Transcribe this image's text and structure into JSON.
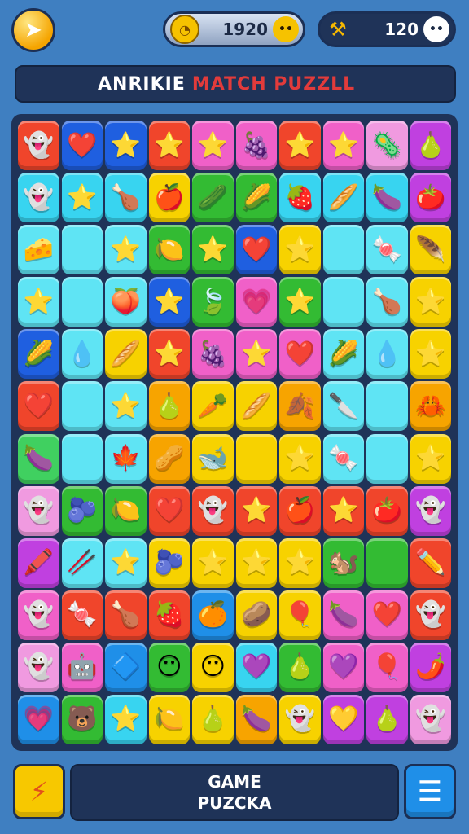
{
  "header": {
    "timer_value": "1920",
    "score_value": "120",
    "icons": {
      "back": "back-arrow-icon",
      "clock": "clock-icon",
      "tool": "hammer-icon",
      "options": "face-icon"
    }
  },
  "title": {
    "part1": "ANRIKIE",
    "part2": "MATCH  PUZZLL"
  },
  "board": {
    "tiles": [
      {
        "r": 0,
        "c": 0,
        "color": "#f0452b",
        "glyph": "👻"
      },
      {
        "r": 0,
        "c": 1,
        "color": "#1f5fe0",
        "glyph": "❤️"
      },
      {
        "r": 0,
        "c": 2,
        "color": "#1f5fe0",
        "glyph": "⭐"
      },
      {
        "r": 0,
        "c": 3,
        "color": "#f0452b",
        "glyph": "⭐"
      },
      {
        "r": 0,
        "c": 4,
        "color": "#f060c8",
        "glyph": "⭐"
      },
      {
        "r": 0,
        "c": 5,
        "color": "#f060c8",
        "glyph": "🍇"
      },
      {
        "r": 0,
        "c": 6,
        "color": "#f0452b",
        "glyph": "⭐"
      },
      {
        "r": 0,
        "c": 7,
        "color": "#f060c8",
        "glyph": "⭐"
      },
      {
        "r": 0,
        "c": 8,
        "color": "#f09ae0",
        "glyph": "🦠"
      },
      {
        "r": 0,
        "c": 9,
        "color": "#c040e0",
        "glyph": "🍐"
      },
      {
        "r": 1,
        "c": 0,
        "color": "#38d4f0",
        "glyph": "👻"
      },
      {
        "r": 1,
        "c": 1,
        "color": "#38d4f0",
        "glyph": "⭐"
      },
      {
        "r": 1,
        "c": 2,
        "color": "#38d4f0",
        "glyph": "🍗"
      },
      {
        "r": 1,
        "c": 3,
        "color": "#f7d200",
        "glyph": "🍎"
      },
      {
        "r": 1,
        "c": 4,
        "color": "#33bb33",
        "glyph": "🥒"
      },
      {
        "r": 1,
        "c": 5,
        "color": "#33bb33",
        "glyph": "🌽"
      },
      {
        "r": 1,
        "c": 6,
        "color": "#38d4f0",
        "glyph": "🍓"
      },
      {
        "r": 1,
        "c": 7,
        "color": "#38d4f0",
        "glyph": "🥖"
      },
      {
        "r": 1,
        "c": 8,
        "color": "#38d4f0",
        "glyph": "🍆"
      },
      {
        "r": 1,
        "c": 9,
        "color": "#c040e0",
        "glyph": "🍅"
      },
      {
        "r": 2,
        "c": 0,
        "color": "#5fe4f4",
        "glyph": "🧀"
      },
      {
        "r": 2,
        "c": 1,
        "color": "#5fe4f4",
        "glyph": ""
      },
      {
        "r": 2,
        "c": 2,
        "color": "#5fe4f4",
        "glyph": "⭐"
      },
      {
        "r": 2,
        "c": 3,
        "color": "#33bb33",
        "glyph": "🍋"
      },
      {
        "r": 2,
        "c": 4,
        "color": "#33bb33",
        "glyph": "⭐"
      },
      {
        "r": 2,
        "c": 5,
        "color": "#1f5fe0",
        "glyph": "❤️"
      },
      {
        "r": 2,
        "c": 6,
        "color": "#f7d200",
        "glyph": "⭐"
      },
      {
        "r": 2,
        "c": 7,
        "color": "#5fe4f4",
        "glyph": ""
      },
      {
        "r": 2,
        "c": 8,
        "color": "#5fe4f4",
        "glyph": "🍬"
      },
      {
        "r": 2,
        "c": 9,
        "color": "#f7d200",
        "glyph": "🪶"
      },
      {
        "r": 3,
        "c": 0,
        "color": "#5fe4f4",
        "glyph": "⭐"
      },
      {
        "r": 3,
        "c": 1,
        "color": "#5fe4f4",
        "glyph": ""
      },
      {
        "r": 3,
        "c": 2,
        "color": "#5fe4f4",
        "glyph": "🍑"
      },
      {
        "r": 3,
        "c": 3,
        "color": "#1f5fe0",
        "glyph": "⭐"
      },
      {
        "r": 3,
        "c": 4,
        "color": "#33bb33",
        "glyph": "🍃"
      },
      {
        "r": 3,
        "c": 5,
        "color": "#f060c8",
        "glyph": "💗"
      },
      {
        "r": 3,
        "c": 6,
        "color": "#33bb33",
        "glyph": "⭐"
      },
      {
        "r": 3,
        "c": 7,
        "color": "#5fe4f4",
        "glyph": ""
      },
      {
        "r": 3,
        "c": 8,
        "color": "#5fe4f4",
        "glyph": "🍗"
      },
      {
        "r": 3,
        "c": 9,
        "color": "#f7d200",
        "glyph": "⭐"
      },
      {
        "r": 4,
        "c": 0,
        "color": "#1f5fe0",
        "glyph": "🌽"
      },
      {
        "r": 4,
        "c": 1,
        "color": "#5fe4f4",
        "glyph": "💧"
      },
      {
        "r": 4,
        "c": 2,
        "color": "#f7d200",
        "glyph": "🥖"
      },
      {
        "r": 4,
        "c": 3,
        "color": "#f0452b",
        "glyph": "⭐"
      },
      {
        "r": 4,
        "c": 4,
        "color": "#f060c8",
        "glyph": "🍇"
      },
      {
        "r": 4,
        "c": 5,
        "color": "#f060c8",
        "glyph": "⭐"
      },
      {
        "r": 4,
        "c": 6,
        "color": "#f060c8",
        "glyph": "❤️"
      },
      {
        "r": 4,
        "c": 7,
        "color": "#5fe4f4",
        "glyph": "🌽"
      },
      {
        "r": 4,
        "c": 8,
        "color": "#5fe4f4",
        "glyph": "💧"
      },
      {
        "r": 4,
        "c": 9,
        "color": "#f7d200",
        "glyph": "⭐"
      },
      {
        "r": 5,
        "c": 0,
        "color": "#f0452b",
        "glyph": "❤️"
      },
      {
        "r": 5,
        "c": 1,
        "color": "#5fe4f4",
        "glyph": ""
      },
      {
        "r": 5,
        "c": 2,
        "color": "#5fe4f4",
        "glyph": "⭐"
      },
      {
        "r": 5,
        "c": 3,
        "color": "#f7a400",
        "glyph": "🍐"
      },
      {
        "r": 5,
        "c": 4,
        "color": "#f7d200",
        "glyph": "🥕"
      },
      {
        "r": 5,
        "c": 5,
        "color": "#f7d200",
        "glyph": "🥖"
      },
      {
        "r": 5,
        "c": 6,
        "color": "#f7a400",
        "glyph": "🍂"
      },
      {
        "r": 5,
        "c": 7,
        "color": "#5fe4f4",
        "glyph": "🔪"
      },
      {
        "r": 5,
        "c": 8,
        "color": "#5fe4f4",
        "glyph": ""
      },
      {
        "r": 5,
        "c": 9,
        "color": "#f7a400",
        "glyph": "🦀"
      },
      {
        "r": 6,
        "c": 0,
        "color": "#40d060",
        "glyph": "🍆"
      },
      {
        "r": 6,
        "c": 1,
        "color": "#5fe4f4",
        "glyph": ""
      },
      {
        "r": 6,
        "c": 2,
        "color": "#5fe4f4",
        "glyph": "🍁"
      },
      {
        "r": 6,
        "c": 3,
        "color": "#f7a400",
        "glyph": "🥜"
      },
      {
        "r": 6,
        "c": 4,
        "color": "#f7d200",
        "glyph": "🐋"
      },
      {
        "r": 6,
        "c": 5,
        "color": "#f7d200",
        "glyph": ""
      },
      {
        "r": 6,
        "c": 6,
        "color": "#f7d200",
        "glyph": "⭐"
      },
      {
        "r": 6,
        "c": 7,
        "color": "#5fe4f4",
        "glyph": "🍬"
      },
      {
        "r": 6,
        "c": 8,
        "color": "#5fe4f4",
        "glyph": ""
      },
      {
        "r": 6,
        "c": 9,
        "color": "#f7d200",
        "glyph": "⭐"
      },
      {
        "r": 7,
        "c": 0,
        "color": "#f09ae0",
        "glyph": "👻"
      },
      {
        "r": 7,
        "c": 1,
        "color": "#33bb33",
        "glyph": "🫐"
      },
      {
        "r": 7,
        "c": 2,
        "color": "#33bb33",
        "glyph": "🍋"
      },
      {
        "r": 7,
        "c": 3,
        "color": "#f0452b",
        "glyph": "❤️"
      },
      {
        "r": 7,
        "c": 4,
        "color": "#f0452b",
        "glyph": "👻"
      },
      {
        "r": 7,
        "c": 5,
        "color": "#f0452b",
        "glyph": "⭐"
      },
      {
        "r": 7,
        "c": 6,
        "color": "#f0452b",
        "glyph": "🍎"
      },
      {
        "r": 7,
        "c": 7,
        "color": "#f0452b",
        "glyph": "⭐"
      },
      {
        "r": 7,
        "c": 8,
        "color": "#f0452b",
        "glyph": "🍅"
      },
      {
        "r": 7,
        "c": 9,
        "color": "#c040e0",
        "glyph": "👻"
      },
      {
        "r": 8,
        "c": 0,
        "color": "#c040e0",
        "glyph": "🖍️"
      },
      {
        "r": 8,
        "c": 1,
        "color": "#5fe4f4",
        "glyph": "🥢"
      },
      {
        "r": 8,
        "c": 2,
        "color": "#5fe4f4",
        "glyph": "⭐"
      },
      {
        "r": 8,
        "c": 3,
        "color": "#f7d200",
        "glyph": "🫐"
      },
      {
        "r": 8,
        "c": 4,
        "color": "#f7d200",
        "glyph": "⭐"
      },
      {
        "r": 8,
        "c": 5,
        "color": "#f7d200",
        "glyph": "⭐"
      },
      {
        "r": 8,
        "c": 6,
        "color": "#f7d200",
        "glyph": "⭐"
      },
      {
        "r": 8,
        "c": 7,
        "color": "#33bb33",
        "glyph": "🐿️"
      },
      {
        "r": 8,
        "c": 8,
        "color": "#33bb33",
        "glyph": ""
      },
      {
        "r": 8,
        "c": 9,
        "color": "#f0452b",
        "glyph": "✏️"
      },
      {
        "r": 9,
        "c": 0,
        "color": "#f060c8",
        "glyph": "👻"
      },
      {
        "r": 9,
        "c": 1,
        "color": "#f0452b",
        "glyph": "🍬"
      },
      {
        "r": 9,
        "c": 2,
        "color": "#f0452b",
        "glyph": "🍗"
      },
      {
        "r": 9,
        "c": 3,
        "color": "#f0452b",
        "glyph": "🍓"
      },
      {
        "r": 9,
        "c": 4,
        "color": "#1f8fe8",
        "glyph": "🍊"
      },
      {
        "r": 9,
        "c": 5,
        "color": "#f7d200",
        "glyph": "🥔"
      },
      {
        "r": 9,
        "c": 6,
        "color": "#f7d200",
        "glyph": "🎈"
      },
      {
        "r": 9,
        "c": 7,
        "color": "#f060c8",
        "glyph": "🍆"
      },
      {
        "r": 9,
        "c": 8,
        "color": "#f060c8",
        "glyph": "❤️"
      },
      {
        "r": 9,
        "c": 9,
        "color": "#f0452b",
        "glyph": "👻"
      },
      {
        "r": 10,
        "c": 0,
        "color": "#f09ae0",
        "glyph": "👻"
      },
      {
        "r": 10,
        "c": 1,
        "color": "#f060c8",
        "glyph": "🤖"
      },
      {
        "r": 10,
        "c": 2,
        "color": "#1f8fe8",
        "glyph": "🔷"
      },
      {
        "r": 10,
        "c": 3,
        "color": "#33bb33",
        "glyph": "😶"
      },
      {
        "r": 10,
        "c": 4,
        "color": "#f7d200",
        "glyph": "😶"
      },
      {
        "r": 10,
        "c": 5,
        "color": "#38d4f0",
        "glyph": "💜"
      },
      {
        "r": 10,
        "c": 6,
        "color": "#33bb33",
        "glyph": "🍐"
      },
      {
        "r": 10,
        "c": 7,
        "color": "#f060c8",
        "glyph": "💜"
      },
      {
        "r": 10,
        "c": 8,
        "color": "#f060c8",
        "glyph": "🎈"
      },
      {
        "r": 10,
        "c": 9,
        "color": "#c040e0",
        "glyph": "🌶️"
      },
      {
        "r": 11,
        "c": 0,
        "color": "#1f8fe8",
        "glyph": "💗"
      },
      {
        "r": 11,
        "c": 1,
        "color": "#33bb33",
        "glyph": "🐻"
      },
      {
        "r": 11,
        "c": 2,
        "color": "#38d4f0",
        "glyph": "⭐"
      },
      {
        "r": 11,
        "c": 3,
        "color": "#f7d200",
        "glyph": "🍋"
      },
      {
        "r": 11,
        "c": 4,
        "color": "#f7d200",
        "glyph": "🍐"
      },
      {
        "r": 11,
        "c": 5,
        "color": "#f7a400",
        "glyph": "🍆"
      },
      {
        "r": 11,
        "c": 6,
        "color": "#f7d200",
        "glyph": "👻"
      },
      {
        "r": 11,
        "c": 7,
        "color": "#c040e0",
        "glyph": "💛"
      },
      {
        "r": 11,
        "c": 8,
        "color": "#c040e0",
        "glyph": "🍐"
      },
      {
        "r": 11,
        "c": 9,
        "color": "#f09ae0",
        "glyph": "👻"
      }
    ]
  },
  "footer": {
    "panel_line1": "GAME",
    "panel_line2": "PUZCKA",
    "icons": {
      "left": "lightning-icon",
      "right": "menu-icon"
    }
  }
}
